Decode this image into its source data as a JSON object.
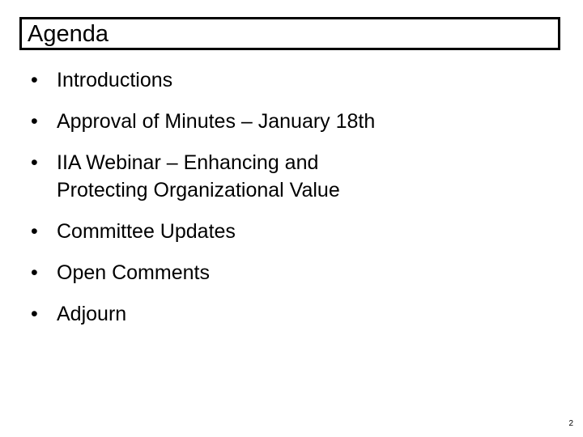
{
  "slide": {
    "title": "Agenda",
    "page_number": "2",
    "background_color": "#ffffff",
    "text_color": "#000000",
    "title_border_color": "#000000",
    "bullet_glyph": "•",
    "bullets": [
      {
        "text": "Introductions"
      },
      {
        "text": "Approval of Minutes – January 18th"
      },
      {
        "text": "IIA Webinar – Enhancing and Protecting Organizational Value"
      },
      {
        "text": "Committee Updates"
      },
      {
        "text": "Open Comments"
      },
      {
        "text": "Adjourn"
      }
    ]
  }
}
